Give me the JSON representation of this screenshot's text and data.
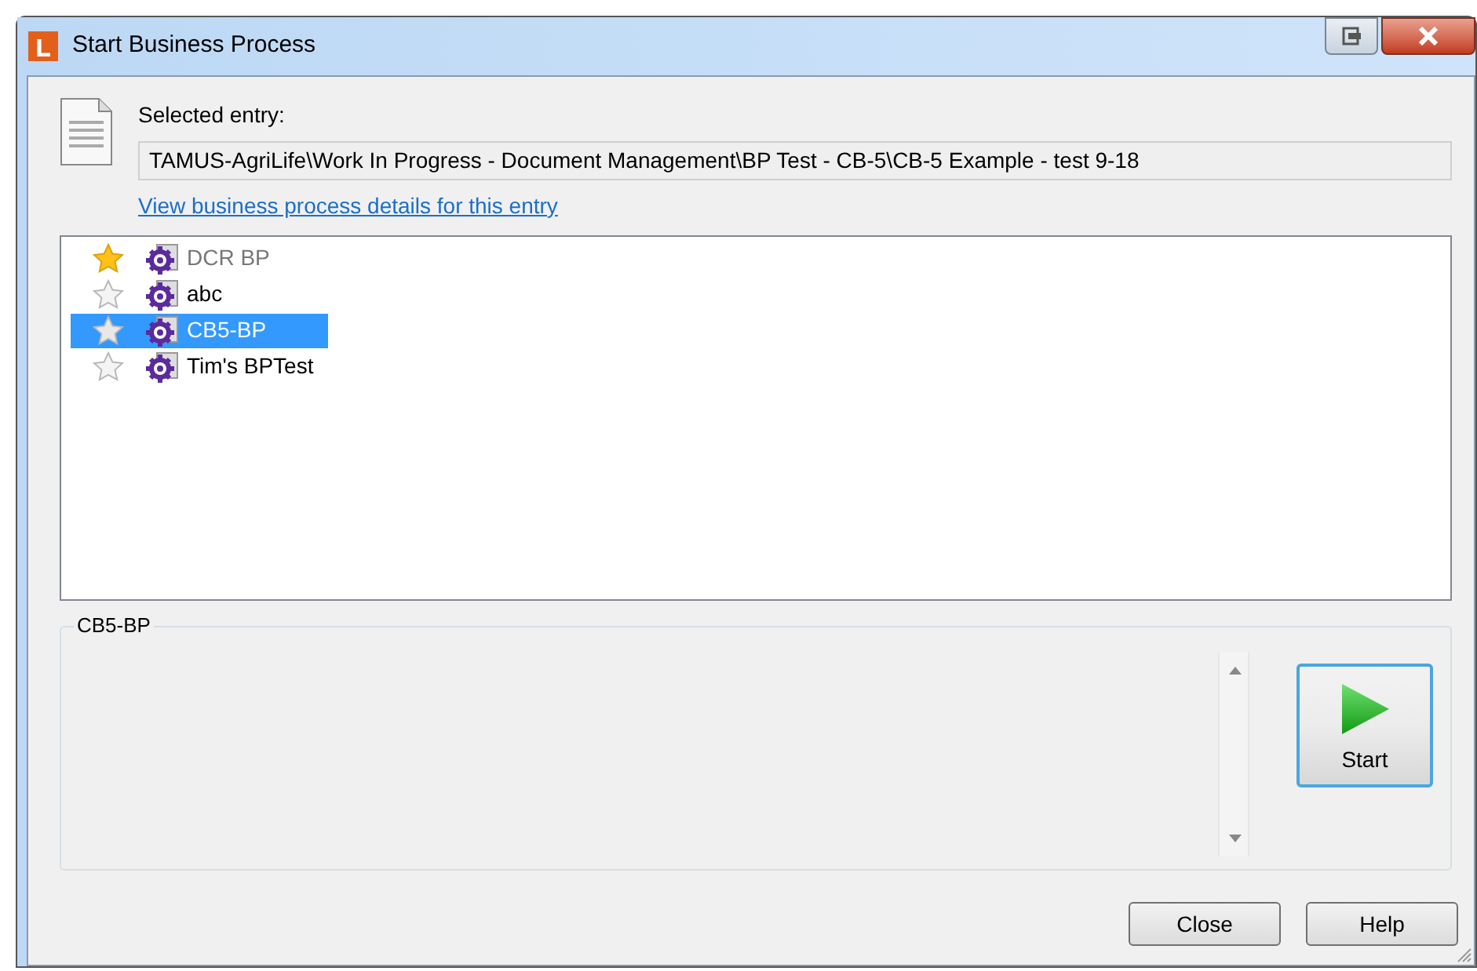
{
  "window": {
    "title": "Start Business Process"
  },
  "entry": {
    "label": "Selected entry:",
    "value": "TAMUS-AgriLife\\Work In Progress - Document Management\\BP Test - CB-5\\CB-5 Example - test 9-18",
    "link": "View business process details for this entry"
  },
  "processes": [
    {
      "name": "DCR BP",
      "favorite": true,
      "disabled": true,
      "selected": false
    },
    {
      "name": "abc",
      "favorite": false,
      "disabled": false,
      "selected": false
    },
    {
      "name": "CB5-BP",
      "favorite": false,
      "disabled": false,
      "selected": true
    },
    {
      "name": "Tim's BPTest",
      "favorite": false,
      "disabled": false,
      "selected": false
    }
  ],
  "details": {
    "title": "CB5-BP",
    "start_button": "Start"
  },
  "buttons": [
    "Close",
    "Help"
  ]
}
